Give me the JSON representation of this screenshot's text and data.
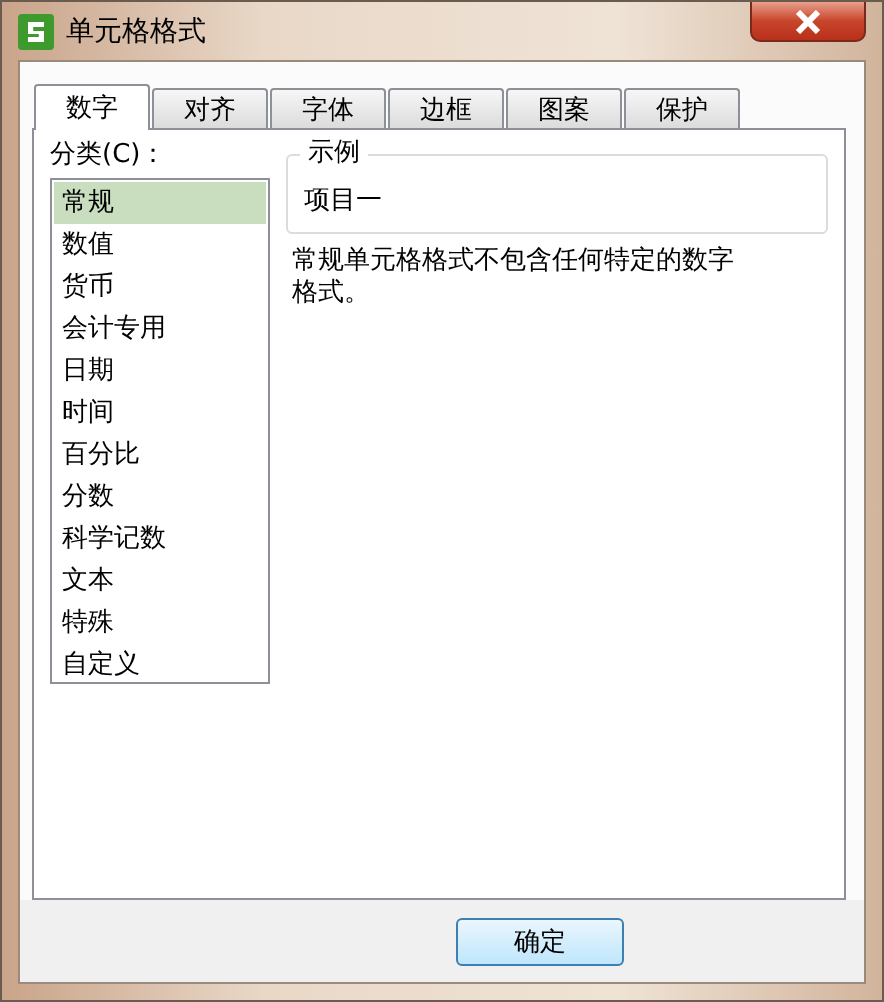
{
  "window": {
    "title": "单元格格式"
  },
  "tabs": [
    {
      "label": "数字",
      "selected": true
    },
    {
      "label": "对齐",
      "selected": false
    },
    {
      "label": "字体",
      "selected": false
    },
    {
      "label": "边框",
      "selected": false
    },
    {
      "label": "图案",
      "selected": false
    },
    {
      "label": "保护",
      "selected": false
    }
  ],
  "category": {
    "label": "分类(C)：",
    "items": [
      {
        "label": "常规",
        "selected": true
      },
      {
        "label": "数值",
        "selected": false
      },
      {
        "label": "货币",
        "selected": false
      },
      {
        "label": "会计专用",
        "selected": false
      },
      {
        "label": "日期",
        "selected": false
      },
      {
        "label": "时间",
        "selected": false
      },
      {
        "label": "百分比",
        "selected": false
      },
      {
        "label": "分数",
        "selected": false
      },
      {
        "label": "科学记数",
        "selected": false
      },
      {
        "label": "文本",
        "selected": false
      },
      {
        "label": "特殊",
        "selected": false
      },
      {
        "label": "自定义",
        "selected": false
      }
    ]
  },
  "sample": {
    "legend": "示例",
    "value": "项目一"
  },
  "description": "常规单元格格式不包含任何特定的数字格式。",
  "buttons": [
    "确定"
  ]
}
